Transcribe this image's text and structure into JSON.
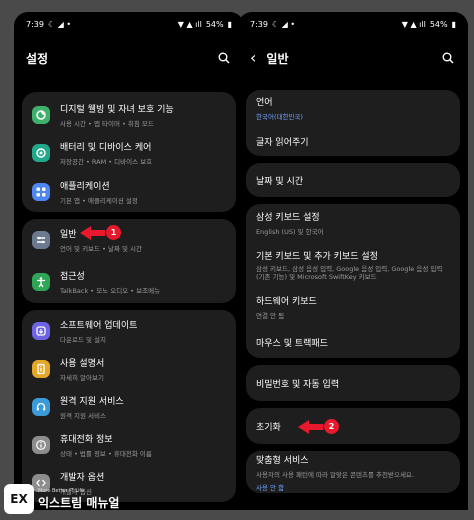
{
  "left": {
    "status": {
      "time": "7:39",
      "battery": "54%"
    },
    "header": {
      "title": "설정"
    },
    "groups": [
      [
        {
          "title": "디지털 웰빙 및 자녀 보호 기능",
          "subtitle": "사용 시간 • 앱 타이머 • 취침 모드",
          "icon": "wellbeing-icon",
          "color": "#3fb06b"
        },
        {
          "title": "배터리 및 디바이스 케어",
          "subtitle": "저장공간 • RAM • 디바이스 보호",
          "icon": "device-care-icon",
          "color": "#22a88a"
        },
        {
          "title": "애플리케이션",
          "subtitle": "기본 앱 • 애플리케이션 설정",
          "icon": "apps-icon",
          "color": "#4e86f2"
        }
      ],
      [
        {
          "title": "일반",
          "subtitle": "언어 및 키보드 • 날짜 및 시간",
          "icon": "general-management-icon",
          "color": "#6c7a90"
        },
        {
          "title": "접근성",
          "subtitle": "TalkBack • 모노 오디오 • 보조메뉴",
          "icon": "accessibility-icon",
          "color": "#2fa557"
        }
      ],
      [
        {
          "title": "소프트웨어 업데이트",
          "subtitle": "다운로드 및 설치",
          "icon": "software-update-icon",
          "color": "#6d63e6"
        },
        {
          "title": "사용 설명서",
          "subtitle": "자세히 알아보기",
          "icon": "user-manual-icon",
          "color": "#e3a72a"
        },
        {
          "title": "원격 지원 서비스",
          "subtitle": "원격 지원 서비스",
          "icon": "remote-support-icon",
          "color": "#3b9bd8"
        },
        {
          "title": "휴대전화 정보",
          "subtitle": "상태 • 법률 정보 • 휴대전화 이름",
          "icon": "phone-info-icon",
          "color": "#8d8d8d"
        },
        {
          "title": "개발자 옵션",
          "subtitle": "개발자 옵션",
          "icon": "developer-options-icon",
          "color": "#8d8d8d"
        }
      ]
    ],
    "callout_number": "1"
  },
  "right": {
    "status": {
      "time": "7:39",
      "battery": "54%"
    },
    "header": {
      "title": "일반"
    },
    "groups": [
      [
        {
          "title": "언어",
          "subtitle": "한국어(대한민국)",
          "accent": true
        },
        {
          "title": "글자 읽어주기",
          "subtitle": ""
        }
      ],
      [
        {
          "title": "날짜 및 시간",
          "subtitle": ""
        }
      ],
      [
        {
          "title": "삼성 키보드 설정",
          "subtitle": "English (US) 및 한국어"
        },
        {
          "title": "기본 키보드 및 추가 키보드 설정",
          "subtitle": "삼성 키보드, 삼성 음성 입력, Google 음성 입력, Google 음성 입력(기존 기능) 및 Microsoft SwiftKey 키보드",
          "wrap": true
        },
        {
          "title": "하드웨어 키보드",
          "subtitle": "연결 안 됨"
        },
        {
          "title": "마우스 및 트랙패드",
          "subtitle": ""
        }
      ],
      [
        {
          "title": "비밀번호 및 자동 입력",
          "subtitle": ""
        }
      ],
      [
        {
          "title": "초기화",
          "subtitle": ""
        }
      ],
      [
        {
          "title": "맞춤형 서비스",
          "subtitle": "사용자의 사용 패턴에 따라 알맞은 콘텐츠를 추천받으세요.",
          "subtitle2": "사용 안 함"
        }
      ]
    ],
    "callout_number": "2"
  },
  "watermark": {
    "logo": "EX",
    "tagline": "More Better IT Life",
    "brand": "익스트림 매뉴얼"
  }
}
